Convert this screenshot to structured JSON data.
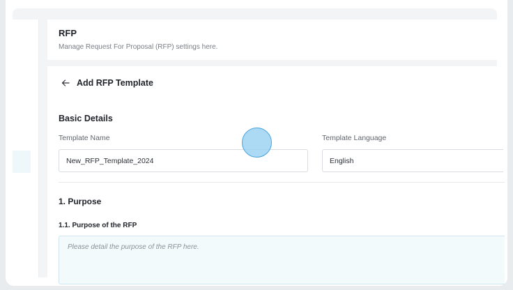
{
  "header": {
    "title": "RFP",
    "subtitle": "Manage Request For Proposal (RFP) settings here."
  },
  "form": {
    "back_label": "Add RFP Template",
    "basic_details": {
      "heading": "Basic Details",
      "template_name_label": "Template Name",
      "template_name_value": "New_RFP_Template_2024",
      "template_language_label": "Template Language",
      "template_language_value": "English"
    },
    "purpose": {
      "heading": "1. Purpose",
      "sub_heading": "1.1. Purpose of the RFP",
      "placeholder": "Please detail the purpose of the RFP here."
    }
  },
  "icons": {
    "back": "arrow-left-icon"
  },
  "colors": {
    "accent_light": "#eef8fb",
    "cursor_fill": "#90cdf0",
    "cursor_border": "#4aa3df"
  }
}
